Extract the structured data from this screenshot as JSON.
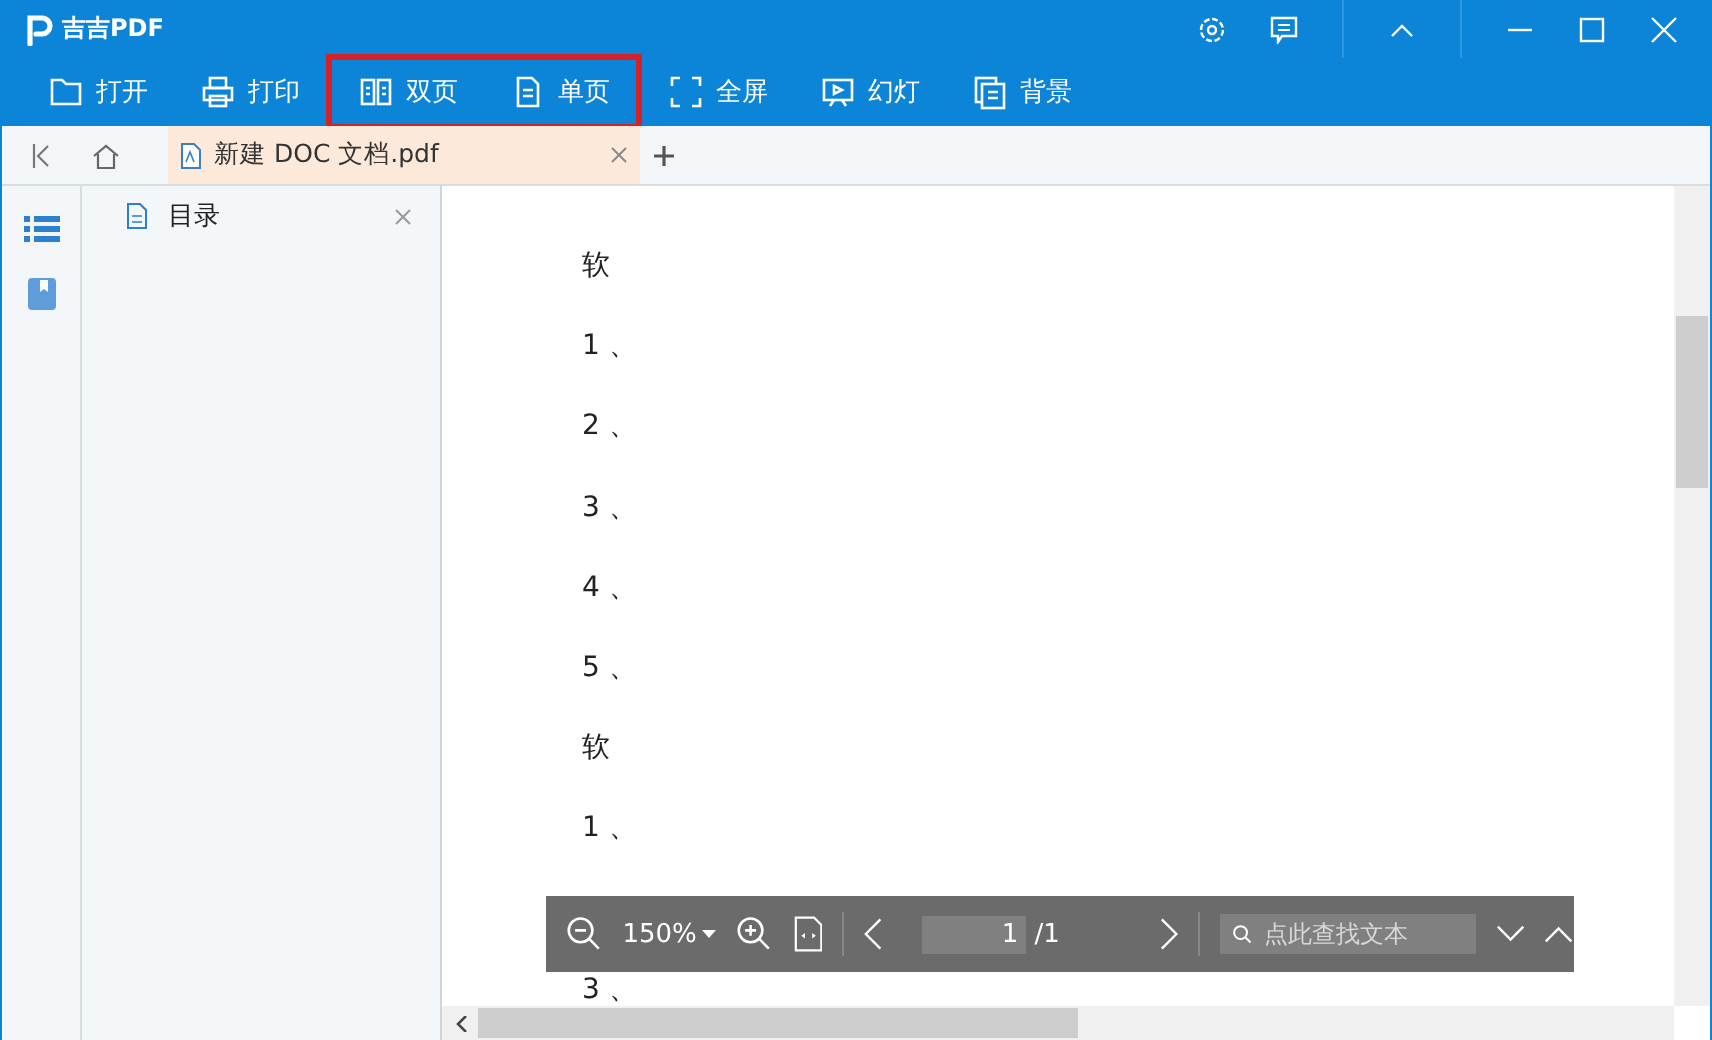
{
  "app": {
    "title": "吉吉PDF"
  },
  "toolbar": [
    {
      "label": "打开",
      "kind": "folder",
      "highlighted": false
    },
    {
      "label": "打印",
      "kind": "printer",
      "highlighted": false
    },
    {
      "label": "双页",
      "kind": "double",
      "highlighted": true
    },
    {
      "label": "单页",
      "kind": "single",
      "highlighted": true
    },
    {
      "label": "全屏",
      "kind": "fullscreen",
      "highlighted": false
    },
    {
      "label": "幻灯",
      "kind": "slides",
      "highlighted": false
    },
    {
      "label": "背景",
      "kind": "background",
      "highlighted": false
    }
  ],
  "tabs": [
    {
      "label": "新建 DOC 文档.pdf",
      "selected": true
    }
  ],
  "sidebar": {
    "items": [
      {
        "kind": "list",
        "selected": true
      },
      {
        "kind": "bookmark",
        "selected": false
      }
    ]
  },
  "panel": {
    "title": "目录"
  },
  "document": {
    "lines": [
      "软",
      "1 、",
      "2 、",
      "3 、",
      "4 、",
      "5 、",
      "软",
      "1 、",
      "3 、"
    ]
  },
  "viewer_bar": {
    "zoom": "150%",
    "page": "1",
    "total": "/1",
    "search": {
      "placeholder": "点此查找文本"
    }
  }
}
